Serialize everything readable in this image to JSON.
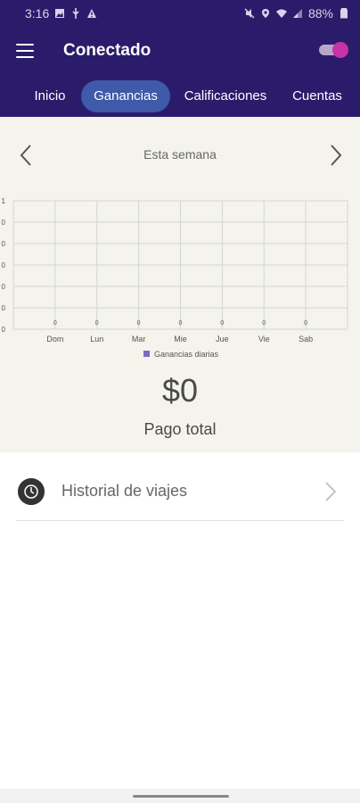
{
  "status_bar": {
    "time": "3:16",
    "battery": "88%"
  },
  "app_bar": {
    "title": "Conectado",
    "online_toggle_on": true
  },
  "tabs": [
    {
      "label": "Inicio",
      "active": false
    },
    {
      "label": "Ganancias",
      "active": true
    },
    {
      "label": "Calificaciones",
      "active": false
    },
    {
      "label": "Cuentas",
      "active": false
    }
  ],
  "week": {
    "label": "Esta semana"
  },
  "chart_data": {
    "type": "bar",
    "categories": [
      "Dom",
      "Lun",
      "Mar",
      "Mie",
      "Jue",
      "Vie",
      "Sab"
    ],
    "series": [
      {
        "name": "Ganancias diarias",
        "values": [
          0,
          0,
          0,
          0,
          0,
          0,
          0
        ],
        "color": "#7b6cc4"
      }
    ],
    "y_tick_labels": [
      "0",
      "0",
      "0",
      "0",
      "0",
      "0",
      "1"
    ],
    "data_labels": [
      "0",
      "0",
      "0",
      "0",
      "0",
      "0",
      "0"
    ],
    "ylim": [
      0,
      1
    ],
    "grid": true,
    "legend_position": "bottom-center"
  },
  "summary": {
    "total": "$0",
    "total_label": "Pago total"
  },
  "history": {
    "label": "Historial de viajes"
  },
  "colors": {
    "app_bar": "#2b1c6b",
    "active_tab": "#3e5aa8",
    "toggle_knob": "#c832a6",
    "panel_background": "#f4f3ec"
  }
}
